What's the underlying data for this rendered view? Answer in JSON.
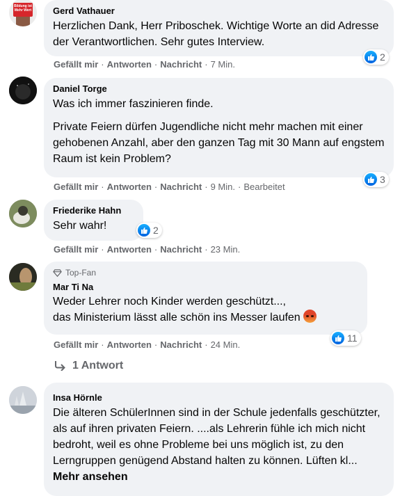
{
  "actions": {
    "like": "Gefällt mir",
    "reply": "Antworten",
    "message": "Nachricht",
    "dot": "·"
  },
  "comments": [
    {
      "author": "Gerd Vathauer",
      "avatar_text": "Bildung ist Mehr Wert",
      "paragraphs": [
        "Herzlichen Dank, Herr Priboschek. Wichtige Worte an did Adresse der Verantwortlichen. Sehr gutes Interview."
      ],
      "time": "7 Min.",
      "reactions": "2"
    },
    {
      "author": "Daniel Torge",
      "paragraphs": [
        "Was ich immer faszinieren finde.",
        "Private Feiern dürfen Jugendliche nicht mehr machen mit einer gehobenen Anzahl, aber den ganzen Tag mit 30 Mann auf engstem Raum ist kein Problem?"
      ],
      "time": "9 Min.",
      "edited": "Bearbeitet",
      "reactions": "3"
    },
    {
      "author": "Friederike Hahn",
      "paragraphs": [
        "Sehr wahr!"
      ],
      "time": "23 Min.",
      "reactions": "2"
    },
    {
      "badge": "Top-Fan",
      "author": "Mar Ti Na",
      "paragraphs": [
        "Weder Lehrer noch Kinder werden geschützt..., ",
        "das Ministerium lässt alle schön ins Messer laufen"
      ],
      "time": "24 Min.",
      "reactions": "11",
      "reply_count": "1 Antwort"
    },
    {
      "author": "Insa Hörnle",
      "paragraphs": [
        "Die älteren SchülerInnen sind in der Schule jedenfalls geschützter, als auf ihren privaten Feiern. ....als Lehrerin fühle ich mich nicht bedroht, weil es ohne Probleme bei uns möglich ist, zu den Lerngruppen genügend Abstand halten zu können. Lüften kl..."
      ],
      "see_more": "Mehr ansehen"
    }
  ]
}
